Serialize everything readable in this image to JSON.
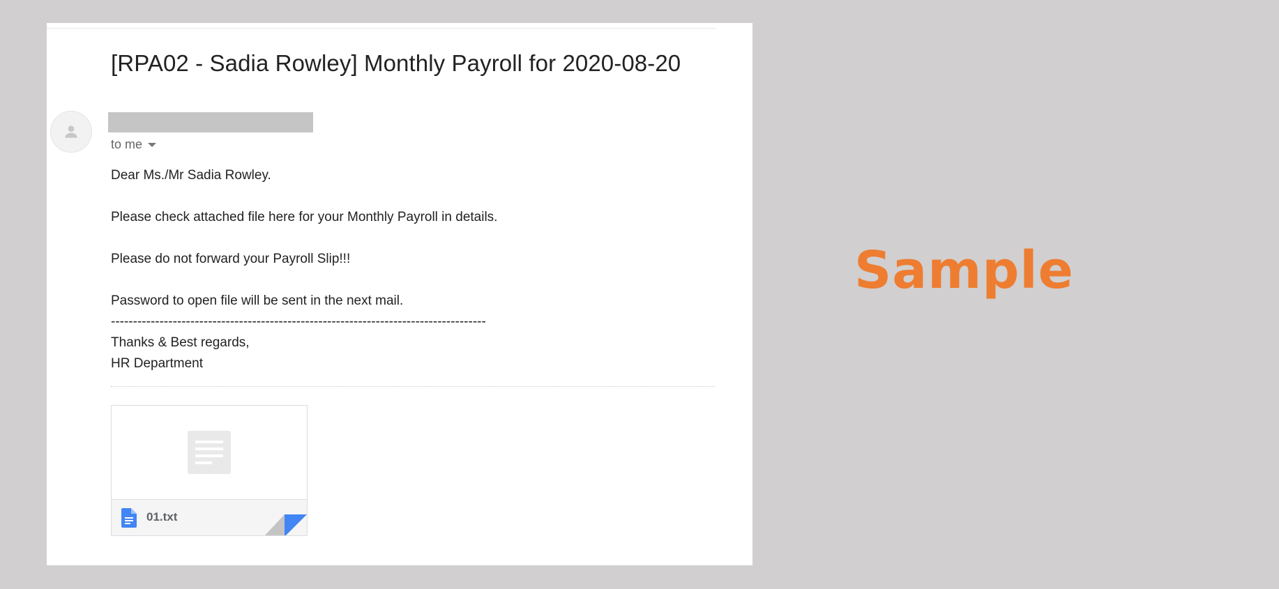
{
  "email": {
    "subject": "[RPA02 - Sadia Rowley] Monthly Payroll for 2020-08-20",
    "recipients_label": "to me",
    "body_lines": [
      "Dear Ms./Mr Sadia Rowley.",
      "",
      "Please check attached file here for your Monthly Payroll in details.",
      "",
      "Please do not forward your Payroll Slip!!!",
      "",
      "Password to open file will be sent in the next mail.",
      "-------------------------------------------------------------------------------------",
      "Thanks & Best regards,",
      "HR Department"
    ],
    "attachment": {
      "filename": "01.txt",
      "icon": "document-icon"
    }
  },
  "watermark": {
    "text": "Sample",
    "color": "#ee7d31"
  },
  "colors": {
    "background": "#d1cfd0",
    "panel": "#ffffff",
    "attachment_accent": "#4285f4"
  }
}
